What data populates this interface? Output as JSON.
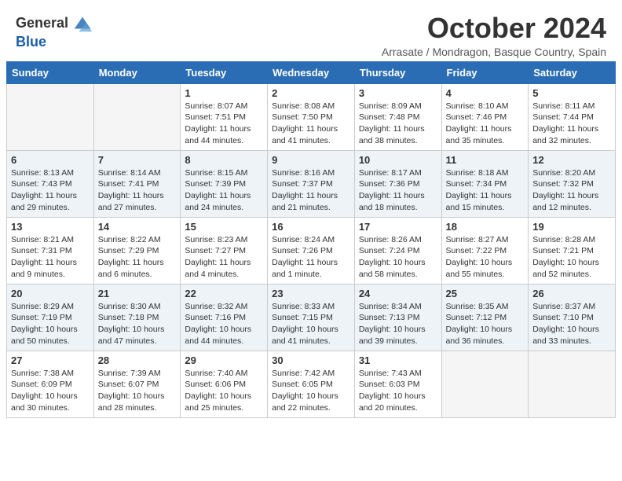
{
  "logo": {
    "line1": "General",
    "line2": "Blue"
  },
  "title": "October 2024",
  "subtitle": "Arrasate / Mondragon, Basque Country, Spain",
  "weekdays": [
    "Sunday",
    "Monday",
    "Tuesday",
    "Wednesday",
    "Thursday",
    "Friday",
    "Saturday"
  ],
  "weeks": [
    [
      {
        "day": "",
        "info": ""
      },
      {
        "day": "",
        "info": ""
      },
      {
        "day": "1",
        "info": "Sunrise: 8:07 AM\nSunset: 7:51 PM\nDaylight: 11 hours and 44 minutes."
      },
      {
        "day": "2",
        "info": "Sunrise: 8:08 AM\nSunset: 7:50 PM\nDaylight: 11 hours and 41 minutes."
      },
      {
        "day": "3",
        "info": "Sunrise: 8:09 AM\nSunset: 7:48 PM\nDaylight: 11 hours and 38 minutes."
      },
      {
        "day": "4",
        "info": "Sunrise: 8:10 AM\nSunset: 7:46 PM\nDaylight: 11 hours and 35 minutes."
      },
      {
        "day": "5",
        "info": "Sunrise: 8:11 AM\nSunset: 7:44 PM\nDaylight: 11 hours and 32 minutes."
      }
    ],
    [
      {
        "day": "6",
        "info": "Sunrise: 8:13 AM\nSunset: 7:43 PM\nDaylight: 11 hours and 29 minutes."
      },
      {
        "day": "7",
        "info": "Sunrise: 8:14 AM\nSunset: 7:41 PM\nDaylight: 11 hours and 27 minutes."
      },
      {
        "day": "8",
        "info": "Sunrise: 8:15 AM\nSunset: 7:39 PM\nDaylight: 11 hours and 24 minutes."
      },
      {
        "day": "9",
        "info": "Sunrise: 8:16 AM\nSunset: 7:37 PM\nDaylight: 11 hours and 21 minutes."
      },
      {
        "day": "10",
        "info": "Sunrise: 8:17 AM\nSunset: 7:36 PM\nDaylight: 11 hours and 18 minutes."
      },
      {
        "day": "11",
        "info": "Sunrise: 8:18 AM\nSunset: 7:34 PM\nDaylight: 11 hours and 15 minutes."
      },
      {
        "day": "12",
        "info": "Sunrise: 8:20 AM\nSunset: 7:32 PM\nDaylight: 11 hours and 12 minutes."
      }
    ],
    [
      {
        "day": "13",
        "info": "Sunrise: 8:21 AM\nSunset: 7:31 PM\nDaylight: 11 hours and 9 minutes."
      },
      {
        "day": "14",
        "info": "Sunrise: 8:22 AM\nSunset: 7:29 PM\nDaylight: 11 hours and 6 minutes."
      },
      {
        "day": "15",
        "info": "Sunrise: 8:23 AM\nSunset: 7:27 PM\nDaylight: 11 hours and 4 minutes."
      },
      {
        "day": "16",
        "info": "Sunrise: 8:24 AM\nSunset: 7:26 PM\nDaylight: 11 hours and 1 minute."
      },
      {
        "day": "17",
        "info": "Sunrise: 8:26 AM\nSunset: 7:24 PM\nDaylight: 10 hours and 58 minutes."
      },
      {
        "day": "18",
        "info": "Sunrise: 8:27 AM\nSunset: 7:22 PM\nDaylight: 10 hours and 55 minutes."
      },
      {
        "day": "19",
        "info": "Sunrise: 8:28 AM\nSunset: 7:21 PM\nDaylight: 10 hours and 52 minutes."
      }
    ],
    [
      {
        "day": "20",
        "info": "Sunrise: 8:29 AM\nSunset: 7:19 PM\nDaylight: 10 hours and 50 minutes."
      },
      {
        "day": "21",
        "info": "Sunrise: 8:30 AM\nSunset: 7:18 PM\nDaylight: 10 hours and 47 minutes."
      },
      {
        "day": "22",
        "info": "Sunrise: 8:32 AM\nSunset: 7:16 PM\nDaylight: 10 hours and 44 minutes."
      },
      {
        "day": "23",
        "info": "Sunrise: 8:33 AM\nSunset: 7:15 PM\nDaylight: 10 hours and 41 minutes."
      },
      {
        "day": "24",
        "info": "Sunrise: 8:34 AM\nSunset: 7:13 PM\nDaylight: 10 hours and 39 minutes."
      },
      {
        "day": "25",
        "info": "Sunrise: 8:35 AM\nSunset: 7:12 PM\nDaylight: 10 hours and 36 minutes."
      },
      {
        "day": "26",
        "info": "Sunrise: 8:37 AM\nSunset: 7:10 PM\nDaylight: 10 hours and 33 minutes."
      }
    ],
    [
      {
        "day": "27",
        "info": "Sunrise: 7:38 AM\nSunset: 6:09 PM\nDaylight: 10 hours and 30 minutes."
      },
      {
        "day": "28",
        "info": "Sunrise: 7:39 AM\nSunset: 6:07 PM\nDaylight: 10 hours and 28 minutes."
      },
      {
        "day": "29",
        "info": "Sunrise: 7:40 AM\nSunset: 6:06 PM\nDaylight: 10 hours and 25 minutes."
      },
      {
        "day": "30",
        "info": "Sunrise: 7:42 AM\nSunset: 6:05 PM\nDaylight: 10 hours and 22 minutes."
      },
      {
        "day": "31",
        "info": "Sunrise: 7:43 AM\nSunset: 6:03 PM\nDaylight: 10 hours and 20 minutes."
      },
      {
        "day": "",
        "info": ""
      },
      {
        "day": "",
        "info": ""
      }
    ]
  ]
}
